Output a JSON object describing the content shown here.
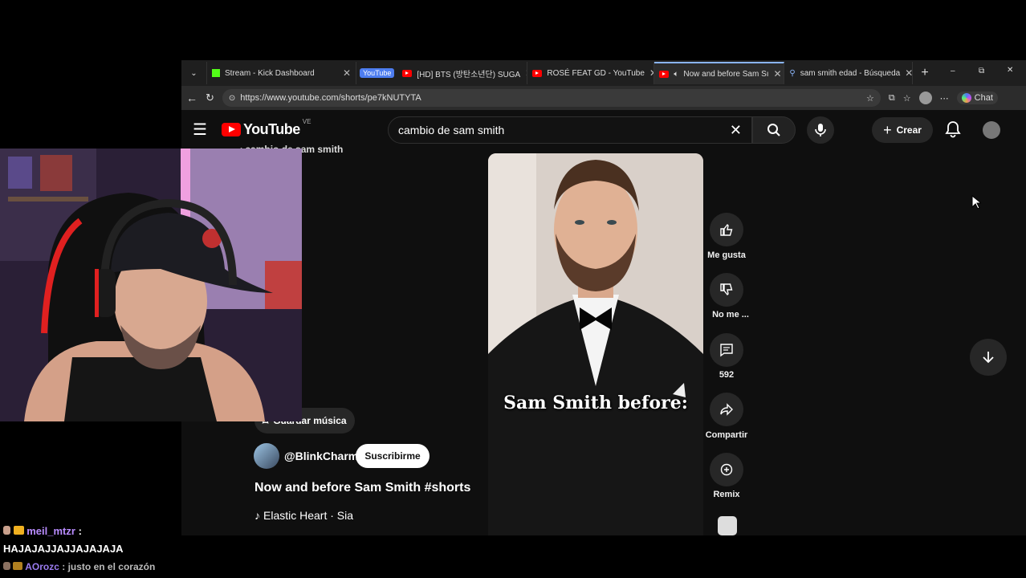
{
  "browser": {
    "tabs": [
      {
        "label": "Stream - Kick Dashboard",
        "icon": "kick-icon"
      },
      {
        "label": "[HD] BTS (방탄소년단) SUGA",
        "icon": "youtube-icon"
      },
      {
        "label": "ROSÉ FEAT GD - YouTube",
        "icon": "youtube-icon"
      },
      {
        "label": "Now and before Sam Sı",
        "icon": "youtube-icon",
        "active": true
      },
      {
        "label": "sam smith edad - Búsqueda",
        "icon": "search-icon"
      }
    ],
    "tab_group_label": "YouTube",
    "url": "https://www.youtube.com/shorts/pe7kNUTYTA",
    "copilot_label": "Chat"
  },
  "youtube": {
    "logo_text": "YouTube",
    "region": "VE",
    "search_value": "cambio de sam smith",
    "create_label": "Crear",
    "back_query": "cambio de sam smith",
    "overlay_text": "Sam Smith before:",
    "rail": {
      "like": "Me gusta",
      "dislike": "No me ...",
      "comments": "592",
      "share": "Compartir",
      "remix": "Remix"
    },
    "save_music": "Guardar música",
    "channel": "@BlinkCharm",
    "subscribe": "Suscribirme",
    "title": "Now and before Sam Smith #shorts",
    "music": "Elastic Heart · Sia"
  },
  "chat": [
    {
      "user": "meil_mtzr",
      "sep": " :",
      "message": "HAJAJAJJAJJAJAJAJA",
      "user_color": "#b98cff"
    },
    {
      "user": "AOrozc",
      "sep": " : ",
      "message": "justo en el corazón",
      "user_color": "#9b7cf0"
    }
  ],
  "colors": {
    "youtube_red": "#ff0000",
    "kick_green": "#53fc18",
    "accent_blue": "#8ab4f8"
  }
}
